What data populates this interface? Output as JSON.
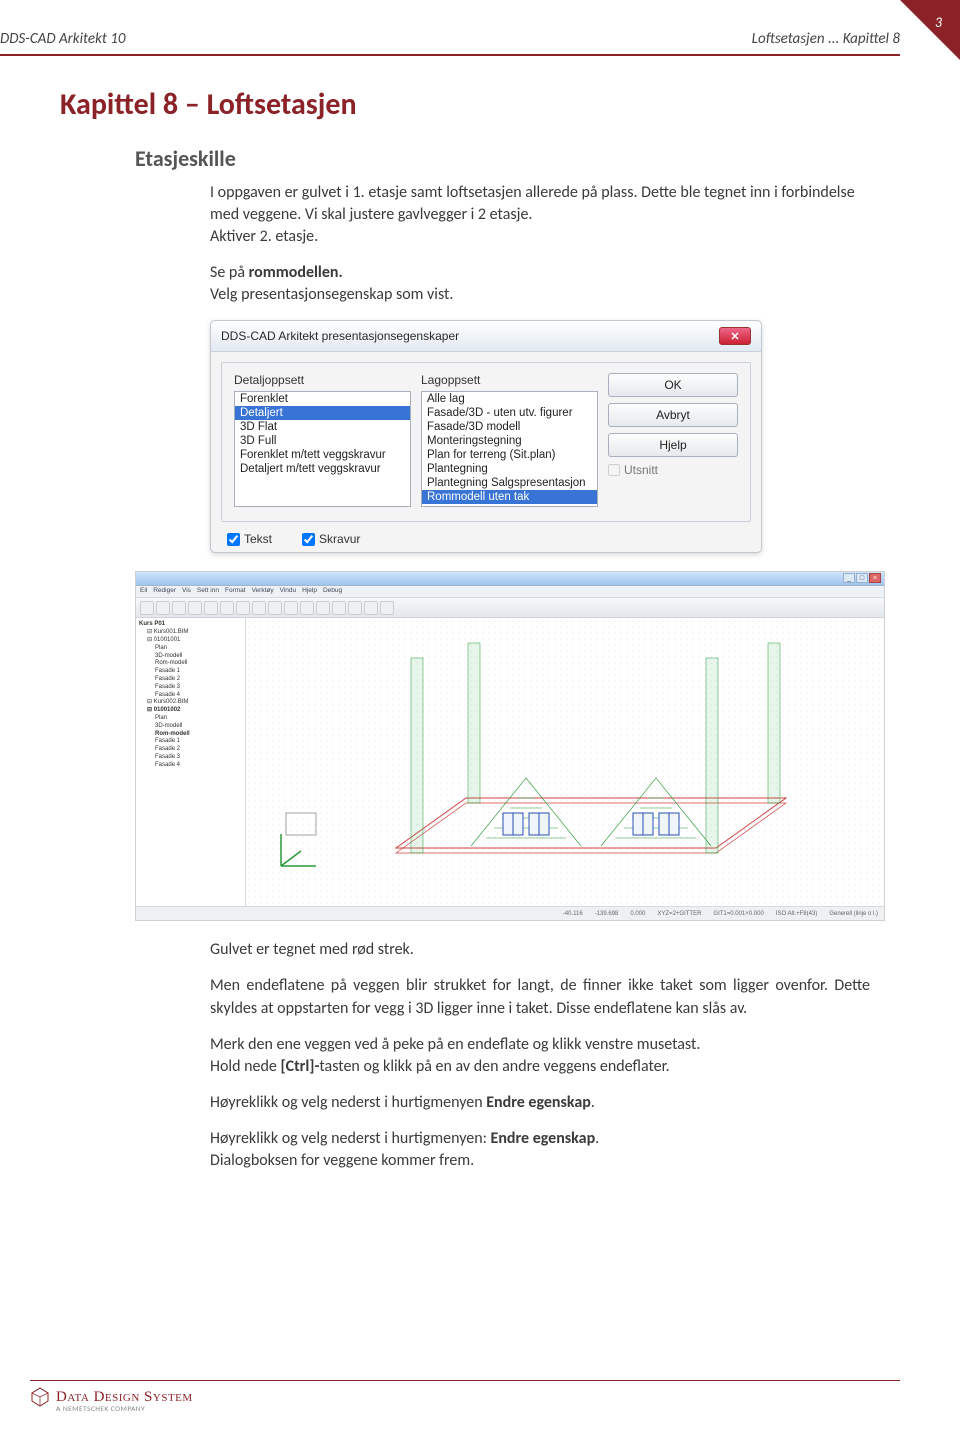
{
  "page_number": "3",
  "header": {
    "left": "DDS-CAD Arkitekt 10",
    "right": "Loftsetasjen ... Kapittel 8"
  },
  "h1": "Kapittel 8 – Loftsetasjen",
  "h2": "Etasjeskille",
  "para1": "I oppgaven er gulvet i 1. etasje samt loftsetasjen allerede på plass. Dette ble tegnet inn i forbindelse med veggene. Vi skal justere gavlvegger i 2 etasje.",
  "para1b": "Aktiver 2. etasje.",
  "para2a": "Se på ",
  "para2b": "rommodellen.",
  "para2c": "Velg presentasjonsegenskap som vist.",
  "dialog": {
    "title": "DDS-CAD Arkitekt presentasjonsegenskaper",
    "col1_label": "Detaljoppsett",
    "col2_label": "Lagoppsett",
    "list1": [
      "Forenklet",
      "Detaljert",
      "3D Flat",
      "3D Full",
      "Forenklet m/tett veggskravur",
      "Detaljert m/tett veggskravur"
    ],
    "list1_selected": 1,
    "list2": [
      "Alle lag",
      "Fasade/3D - uten utv. figurer",
      "Fasade/3D modell",
      "Monteringstegning",
      "Plan for terreng (Sit.plan)",
      "Plantegning",
      "Plantegning Salgspresentasjon",
      "Rommodell uten tak"
    ],
    "list2_selected": 7,
    "btn_ok": "OK",
    "btn_cancel": "Avbryt",
    "btn_help": "Hjelp",
    "chk_utsnitt": "Utsnitt",
    "chk_tekst": "Tekst",
    "chk_skravur": "Skravur"
  },
  "cad": {
    "menus": [
      "Eil",
      "Rediger",
      "Vis",
      "Sett inn",
      "Format",
      "Verktøy",
      "Vindu",
      "Hjelp",
      "Debug"
    ],
    "tree": [
      {
        "t": "Kurs P01",
        "c": "bold"
      },
      {
        "t": "⊟ Kurs001.BIM",
        "c": "ind1"
      },
      {
        "t": "⊟ 01001001",
        "c": "ind1"
      },
      {
        "t": "Plan",
        "c": "ind2"
      },
      {
        "t": "3D-modell",
        "c": "ind2"
      },
      {
        "t": "Rom-modell",
        "c": "ind2"
      },
      {
        "t": "Fasade 1",
        "c": "ind2"
      },
      {
        "t": "Fasade 2",
        "c": "ind2"
      },
      {
        "t": "Fasade 3",
        "c": "ind2"
      },
      {
        "t": "Fasade 4",
        "c": "ind2"
      },
      {
        "t": "⊟ Kurs002.BIM",
        "c": "ind1"
      },
      {
        "t": "⊟ 01001002",
        "c": "ind1 bold"
      },
      {
        "t": "Plan",
        "c": "ind2"
      },
      {
        "t": "3D-modell",
        "c": "ind2"
      },
      {
        "t": "Rom-modell",
        "c": "ind2 bold"
      },
      {
        "t": "Fasade 1",
        "c": "ind2"
      },
      {
        "t": "Fasade 2",
        "c": "ind2"
      },
      {
        "t": "Fasade 3",
        "c": "ind2"
      },
      {
        "t": "Fasade 4",
        "c": "ind2"
      }
    ],
    "status": [
      "-40.116",
      "-139.698",
      "0.000",
      "XYZ=2+GITTER",
      "GIT1=0.001×0.000",
      "ISO Alt.+F8(43)",
      "Generell (linje o l.)"
    ]
  },
  "para3": "Gulvet er tegnet med rød strek.",
  "para4": "Men endeflatene på veggen blir strukket for langt, de finner ikke taket som ligger ovenfor. Dette skyldes at oppstarten for vegg i 3D ligger inne i taket. Disse endeflatene kan slås av.",
  "para5a": "Merk den ene veggen ved å peke på en endeflate og klikk venstre musetast.",
  "para5b_pre": "Hold nede ",
  "para5b_bold": "[Ctrl]-",
  "para5b_post": "tasten og klikk på en av den andre veggens endeflater.",
  "para6_pre": "Høyreklikk og velg nederst i hurtigmenyen ",
  "para6_bold": "Endre egenskap",
  "para6_post": ".",
  "para7_pre": "Høyreklikk og velg nederst i hurtigmenyen: ",
  "para7_bold": "Endre egenskap",
  "para7_post": ".",
  "para8": "Dialogboksen for veggene kommer frem.",
  "footer": {
    "brand": "Data Design System",
    "sub": "A NEMETSCHEK COMPANY"
  }
}
